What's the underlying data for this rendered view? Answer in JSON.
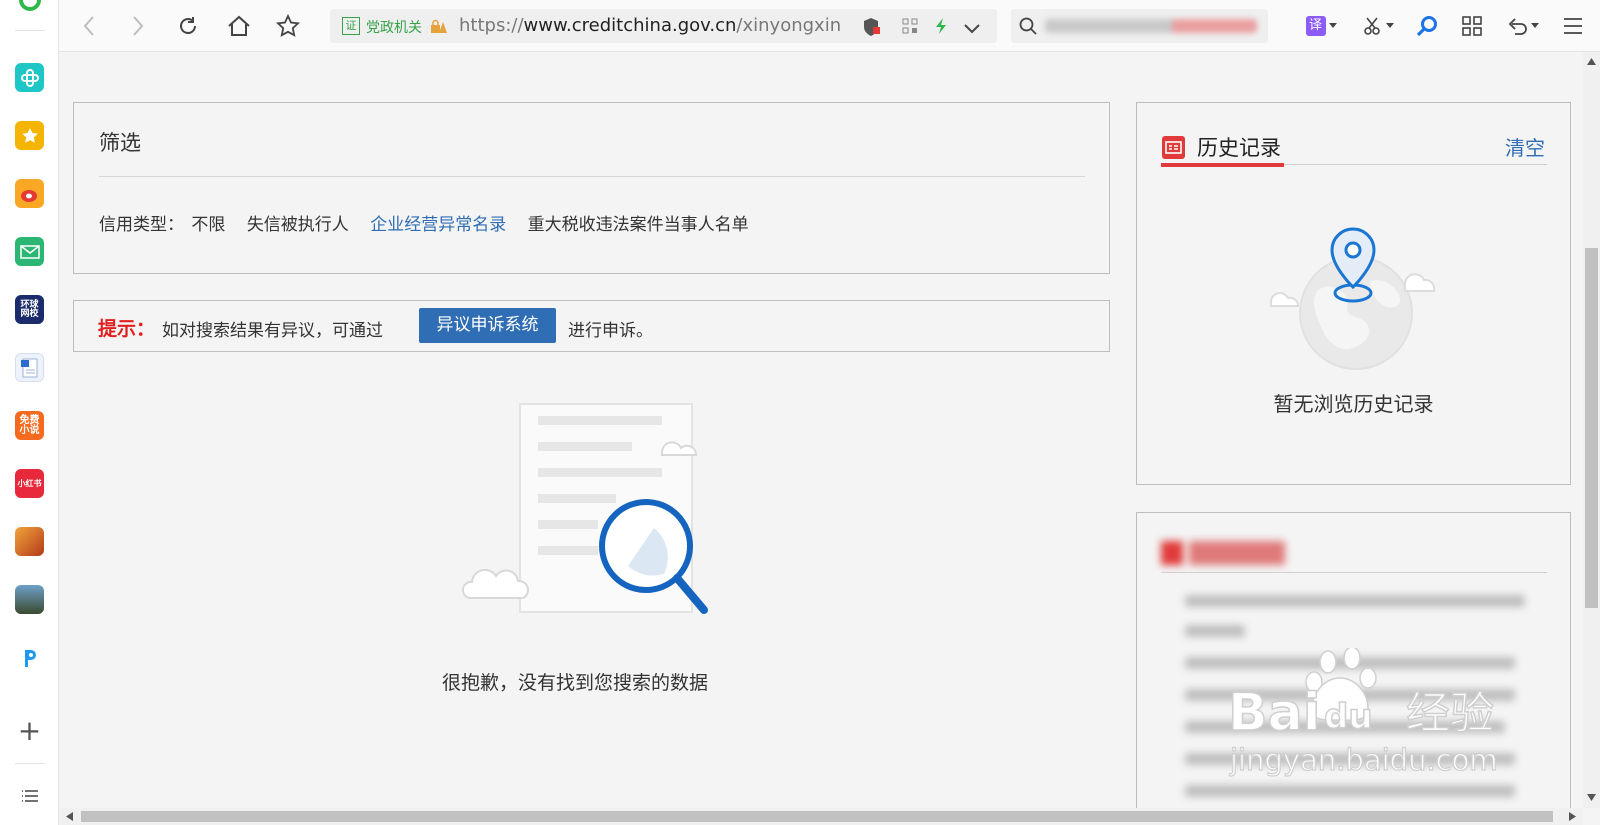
{
  "toolbar": {
    "address": {
      "cert_badge": "证",
      "cert_label": "党政机关",
      "url_prefix": "https://",
      "url_domain": "www.creditchina.gov.cn",
      "url_path": "/xinyongxinxi/ir"
    },
    "translate_label": "译"
  },
  "filter": {
    "title": "筛选",
    "credit_type_label": "信用类型：",
    "options": [
      "不限",
      "失信被执行人",
      "企业经营异常名录",
      "重大税收违法案件当事人名单"
    ],
    "active_option": "企业经营异常名录"
  },
  "tip": {
    "label": "提示：",
    "text": "如对搜索结果有异议，可通过",
    "button": "异议申诉系统",
    "tail": "进行申诉。"
  },
  "empty_result": {
    "message": "很抱歉，没有找到您搜索的数据"
  },
  "history": {
    "title": "历史记录",
    "clear": "清空",
    "empty": "暂无浏览历史记录"
  },
  "sidebar": {
    "icons": [
      "add-app-icon",
      "favorites-icon",
      "weibo-icon",
      "mail-icon",
      "huanqiu-icon",
      "word-doc-icon",
      "free-novel-icon",
      "xiaohongshu-icon",
      "game-icon",
      "pubg-icon",
      "p-app-icon"
    ],
    "more_label": "+"
  },
  "colors": {
    "accent_blue": "#2f6db4",
    "alert_red": "#e02020",
    "cert_green": "#36a24a"
  },
  "watermark": {
    "brand": "Bai",
    "brand_suffix": "du",
    "cn": "经验",
    "url": "jingyan.baidu.com"
  }
}
